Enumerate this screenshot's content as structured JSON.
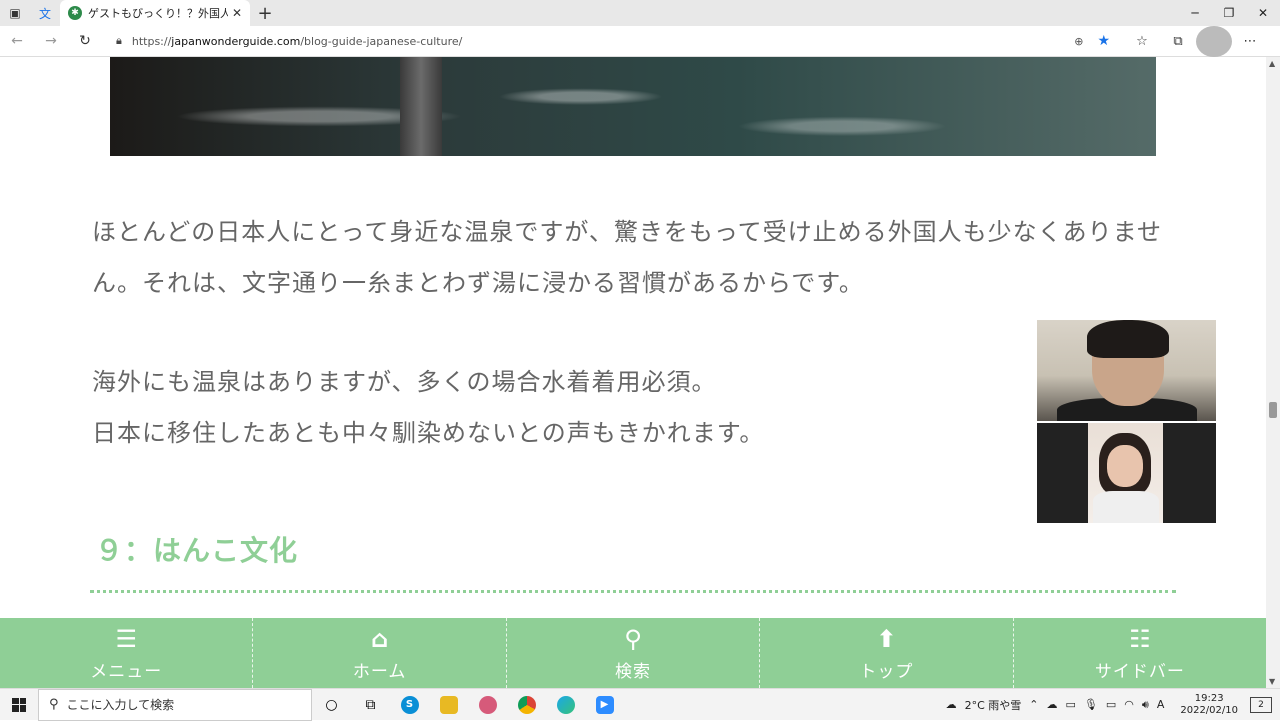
{
  "browser": {
    "tab_title": "ゲストもびっくり！？外国人が驚く日",
    "url_scheme": "https://",
    "url_host": "japanwonderguide.com",
    "url_path": "/blog-guide-japanese-culture/"
  },
  "article": {
    "paragraph1": "ほとんどの日本人にとって身近な温泉ですが、驚きをもって受け止める外国人も少なくありません。それは、文字通り一糸まとわず湯に浸かる習慣があるからです。",
    "paragraph2_line1": "海外にも温泉はありますが、多くの場合水着着用必須。",
    "paragraph2_line2": "日本に移住したあとも中々馴染めないとの声もきかれます。",
    "section_heading": "９：はんこ文化"
  },
  "bottom_nav": [
    {
      "label": "メニュー",
      "icon": "menu-icon"
    },
    {
      "label": "ホーム",
      "icon": "home-icon"
    },
    {
      "label": "検索",
      "icon": "search-icon"
    },
    {
      "label": "トップ",
      "icon": "arrow-up-icon"
    },
    {
      "label": "サイドバー",
      "icon": "sidebar-icon"
    }
  ],
  "taskbar": {
    "search_placeholder": "ここに入力して検索",
    "weather": "2°C 雨や雪",
    "ime": "A",
    "time": "19:23",
    "date": "2022/02/10",
    "notification_count": "2"
  },
  "colors": {
    "accent": "#8fcf96",
    "text": "#666666",
    "link_blue": "#1a73e8"
  }
}
